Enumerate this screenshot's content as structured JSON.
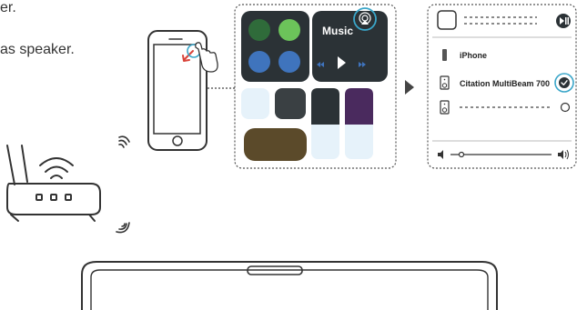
{
  "instructions": {
    "line1": "er.",
    "line2": "as speaker."
  },
  "control_center": {
    "music_label": "Music"
  },
  "output_list": {
    "items": [
      {
        "label": "iPhone",
        "selected": false
      },
      {
        "label": "Citation MultiBeam 700",
        "selected": true
      },
      {
        "label": "",
        "selected": false
      }
    ]
  },
  "icons": [
    "router-icon",
    "wifi-icon",
    "phone-icon",
    "airplay-icon",
    "play-icon",
    "rewind-icon",
    "forward-icon",
    "checkmark-icon",
    "volume-low-icon",
    "volume-high-icon",
    "arrow-right-icon",
    "soundbar-icon"
  ],
  "colors": {
    "highlight_ring": "#3aa6c9",
    "dark_green": "#2f6b3a",
    "light_green": "#6cc35a",
    "blue": "#3f74bd",
    "brown": "#5b4a2a",
    "purple": "#4a2a5e",
    "charcoal": "#2b3236",
    "dark_gray": "#3a4043",
    "pale_blue": "#e6f2fa"
  }
}
